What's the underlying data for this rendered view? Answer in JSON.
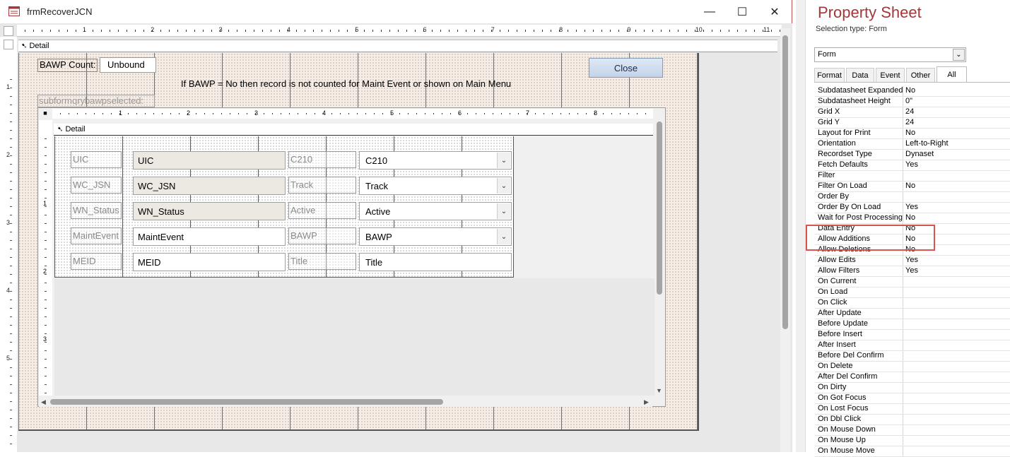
{
  "window": {
    "title": "frmRecoverJCN"
  },
  "caption_buttons": {
    "minimize": "—",
    "maximize": "☐",
    "close": "✕"
  },
  "ruler_numbers": [
    "1",
    "2",
    "3",
    "4",
    "5",
    "6",
    "7",
    "8",
    "9",
    "10",
    "11"
  ],
  "left_ruler_numbers": [
    "1",
    "2",
    "3",
    "4",
    "5"
  ],
  "main": {
    "detail_label": "Detail",
    "bawp_count_label": "BAWP Count:",
    "bawp_count_value": "Unbound",
    "close_button": "Close",
    "note": "If BAWP = No then record is not counted for Maint Event or shown on Main Menu",
    "subform_label": "subformqrybawpselected:"
  },
  "subform": {
    "ruler_numbers": [
      "1",
      "2",
      "3",
      "4",
      "5",
      "6",
      "7",
      "8"
    ],
    "left_ruler_numbers": [
      "1",
      "2",
      "3"
    ],
    "detail_label": "Detail",
    "rows": [
      {
        "label1": "UIC",
        "field1": "UIC",
        "label2": "C210",
        "field2": "C210",
        "combo": true,
        "locked": true
      },
      {
        "label1": "WC_JSN",
        "field1": "WC_JSN",
        "label2": "Track",
        "field2": "Track",
        "combo": true,
        "locked": true
      },
      {
        "label1": "WN_Status",
        "field1": "WN_Status",
        "label2": "Active",
        "field2": "Active",
        "combo": true,
        "locked": true
      },
      {
        "label1": "MaintEvent",
        "field1": "MaintEvent",
        "label2": "BAWP",
        "field2": "BAWP",
        "combo": true,
        "locked": false
      },
      {
        "label1": "MEID",
        "field1": "MEID",
        "label2": "Title",
        "field2": "Title",
        "combo": false,
        "locked": false
      }
    ]
  },
  "property_sheet": {
    "title": "Property Sheet",
    "selection_type": "Selection type:  Form",
    "selector_value": "Form",
    "tabs": [
      "Format",
      "Data",
      "Event",
      "Other",
      "All"
    ],
    "active_tab": "All",
    "properties": [
      {
        "name": "Subdatasheet Expanded",
        "value": "No"
      },
      {
        "name": "Subdatasheet Height",
        "value": "0\""
      },
      {
        "name": "Grid X",
        "value": "24"
      },
      {
        "name": "Grid Y",
        "value": "24"
      },
      {
        "name": "Layout for Print",
        "value": "No"
      },
      {
        "name": "Orientation",
        "value": "Left-to-Right"
      },
      {
        "name": "Recordset Type",
        "value": "Dynaset"
      },
      {
        "name": "Fetch Defaults",
        "value": "Yes"
      },
      {
        "name": "Filter",
        "value": ""
      },
      {
        "name": "Filter On Load",
        "value": "No"
      },
      {
        "name": "Order By",
        "value": ""
      },
      {
        "name": "Order By On Load",
        "value": "Yes"
      },
      {
        "name": "Wait for Post Processing",
        "value": "No"
      },
      {
        "name": "Data Entry",
        "value": "No"
      },
      {
        "name": "Allow Additions",
        "value": "No"
      },
      {
        "name": "Allow Deletions",
        "value": "No"
      },
      {
        "name": "Allow Edits",
        "value": "Yes"
      },
      {
        "name": "Allow Filters",
        "value": "Yes"
      },
      {
        "name": "On Current",
        "value": ""
      },
      {
        "name": "On Load",
        "value": ""
      },
      {
        "name": "On Click",
        "value": ""
      },
      {
        "name": "After Update",
        "value": ""
      },
      {
        "name": "Before Update",
        "value": ""
      },
      {
        "name": "Before Insert",
        "value": ""
      },
      {
        "name": "After Insert",
        "value": ""
      },
      {
        "name": "Before Del Confirm",
        "value": ""
      },
      {
        "name": "On Delete",
        "value": ""
      },
      {
        "name": "After Del Confirm",
        "value": ""
      },
      {
        "name": "On Dirty",
        "value": ""
      },
      {
        "name": "On Got Focus",
        "value": ""
      },
      {
        "name": "On Lost Focus",
        "value": ""
      },
      {
        "name": "On Dbl Click",
        "value": ""
      },
      {
        "name": "On Mouse Down",
        "value": ""
      },
      {
        "name": "On Mouse Up",
        "value": ""
      },
      {
        "name": "On Mouse Move",
        "value": ""
      }
    ],
    "highlight_color": "#d9534f"
  }
}
